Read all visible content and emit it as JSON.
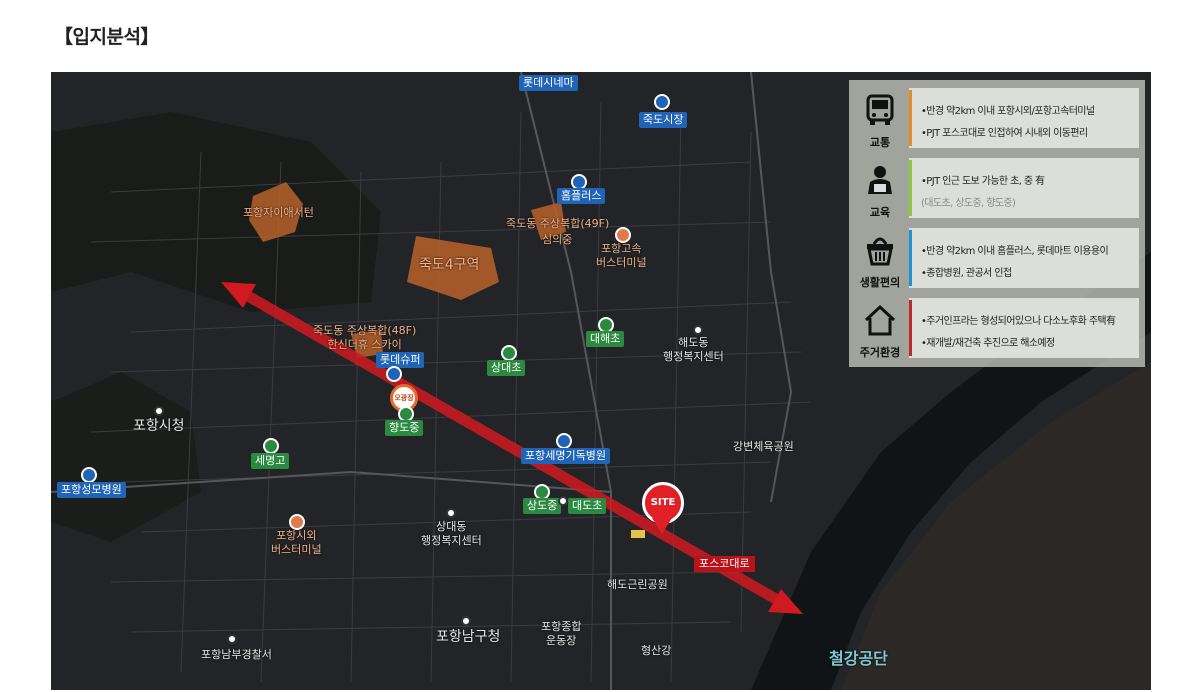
{
  "page": {
    "title": "【입지분석】"
  },
  "map": {
    "labels": {
      "lotte_cinema": "롯데시네마",
      "jukdo_market": "죽도시장",
      "homeplus": "홈플러스",
      "xi_center": "포항자이애서턴",
      "jukdo_49f": "죽도동 주상복합(49F)",
      "simui": "심의중",
      "express_terminal": "포항고속\n버스터미널",
      "jukdo4": "죽도4구역",
      "jukdo_48f": "죽도동 주상복합(48F)\n한신더휴 스카이",
      "lotte_super": "롯데슈퍼",
      "ohsh": "오광장",
      "hyangdo_m": "향도중",
      "sangdae_e": "상대초",
      "daehae_e": "대해초",
      "haedo_center": "해도동\n행정복지센터",
      "city_hall": "포항시청",
      "semyeong_h": "세명고",
      "semyeong_hosp": "포항세명기독병원",
      "gangbyeon": "강변체육공원",
      "seongmo_hosp": "포항성모병원",
      "sangdo_m": "상도중",
      "daedo_e": "대도초",
      "site": "SITE",
      "sangdae_center": "상대동\n행정복지센터",
      "city_terminal": "포항시외\n버스터미널",
      "posco_road": "포스코대로",
      "haedo_park": "해도근린공원",
      "namgu_office": "포항남구청",
      "stadium": "포항종합\n운동장",
      "police": "포항남부경찰서",
      "hyeongsan": "형산강",
      "steel_park": "철강공단"
    },
    "panel": [
      {
        "category": "교통",
        "icon": "bus-icon",
        "color": "#e88a2a",
        "lines": [
          "•반경 약2km 이내 포항시외/포항고속터미널",
          "•PJT 포스코대로 인접하여 시내외 이동편리"
        ]
      },
      {
        "category": "교육",
        "icon": "student-icon",
        "color": "#8dc63f",
        "lines": [
          "•PJT 인근 도보 가능한 초, 중 有",
          "(대도초, 상도중, 향도중)"
        ]
      },
      {
        "category": "생활편의",
        "icon": "basket-icon",
        "color": "#1f8fd6",
        "lines": [
          "•반경 약2km 이내 홈플러스, 롯데마트 이용용이",
          "•종합병원, 관공서 인접"
        ]
      },
      {
        "category": "주거환경",
        "icon": "house-icon",
        "color": "#c0262d",
        "lines": [
          "•주거인프라는 형성되어있으나 다소노후화 주택有",
          "•재개발/재건축 추진으로 해소예정"
        ]
      }
    ]
  }
}
